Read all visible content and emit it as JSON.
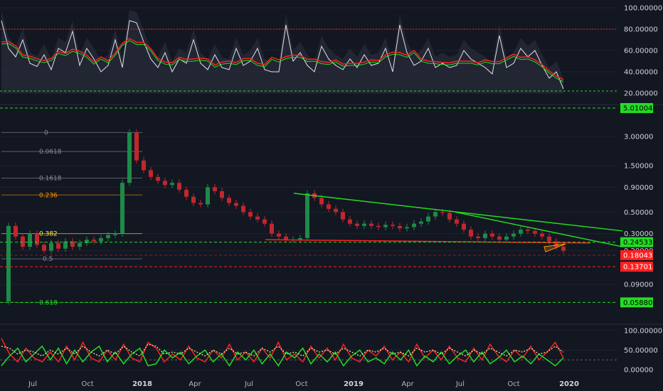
{
  "colors": {
    "background": "#131722",
    "grid": "#1e222d",
    "axis_text": "#d1d4dc",
    "pane_border": "#2a2e39",
    "green": "#22dd22",
    "red": "#ff2020",
    "price_candle_red": "#c1272d",
    "price_candle_green": "#1e8a48",
    "orange": "#ff9800",
    "yellow": "#ffeb3b",
    "fib_grey": "#8a8e99"
  },
  "chart_data": [
    {
      "type": "line",
      "pane": "top-indicator",
      "y_axis_ticks": [
        "100.00000",
        "80.00000",
        "60.00000",
        "40.00000",
        "20.00000"
      ],
      "ylim": [
        20,
        100
      ],
      "hlines": [
        80,
        22
      ],
      "series": [
        {
          "values": [
            88,
            62,
            54,
            70,
            48,
            45,
            56,
            42,
            62,
            58,
            78,
            46,
            62,
            52,
            40,
            46,
            70,
            44,
            88,
            86,
            68,
            52,
            44,
            58,
            40,
            52,
            48,
            70,
            48,
            42,
            56,
            44,
            42,
            62,
            46,
            50,
            62,
            42,
            40,
            40,
            84,
            50,
            58,
            46,
            40,
            64,
            52,
            46,
            42,
            52,
            44,
            56,
            46,
            48,
            62,
            40,
            84,
            58,
            46,
            50,
            62,
            44,
            48,
            44,
            46,
            60,
            52,
            48,
            44,
            38,
            74,
            44,
            48,
            62,
            54,
            60,
            46,
            34,
            40,
            24
          ]
        }
      ],
      "x_range": [
        "2017-05",
        "2019-12"
      ]
    },
    {
      "type": "line",
      "pane": "price",
      "scale": "log",
      "y_axis_ticks": [
        "3.00000",
        "1.50000",
        "0.90000",
        "0.50000",
        "0.30000",
        "0.20000",
        "0.09000"
      ],
      "ylim": [
        0.05,
        4.2
      ],
      "series": [
        {
          "values": [
            0.06,
            0.36,
            0.28,
            0.22,
            0.3,
            0.23,
            0.2,
            0.24,
            0.21,
            0.25,
            0.22,
            0.24,
            0.26,
            0.25,
            0.27,
            0.29,
            0.3,
            1.0,
            3.3,
            1.7,
            1.35,
            1.15,
            1.05,
            0.95,
            1.0,
            0.85,
            0.72,
            0.62,
            0.6,
            0.9,
            0.82,
            0.7,
            0.62,
            0.58,
            0.5,
            0.45,
            0.42,
            0.38,
            0.3,
            0.28,
            0.26,
            0.26,
            0.27,
            0.78,
            0.7,
            0.6,
            0.54,
            0.5,
            0.42,
            0.38,
            0.36,
            0.38,
            0.36,
            0.35,
            0.37,
            0.36,
            0.34,
            0.35,
            0.38,
            0.4,
            0.45,
            0.5,
            0.49,
            0.42,
            0.38,
            0.33,
            0.28,
            0.27,
            0.3,
            0.28,
            0.26,
            0.28,
            0.3,
            0.33,
            0.32,
            0.3,
            0.28,
            0.25,
            0.22,
            0.2
          ]
        }
      ],
      "x_range": [
        "2017-05",
        "2019-12"
      ],
      "fibonacci_levels": [
        {
          "label": "0",
          "value": 3.3
        },
        {
          "label": "0.0618",
          "value": 2.1
        },
        {
          "label": "0.1618",
          "value": 1.12
        },
        {
          "label": "0.236",
          "value": 0.75
        },
        {
          "label": "0.382",
          "value": 0.3
        },
        {
          "label": "0.5",
          "value": 0.165
        },
        {
          "label": "0.618",
          "value": 0.0588
        }
      ],
      "price_tags": [
        {
          "label": "5.01004",
          "color": "#22dd22"
        },
        {
          "label": "0.24533",
          "color": "#22dd22"
        },
        {
          "label": "0.18043",
          "color": "#ff2020"
        },
        {
          "label": "0.13701",
          "color": "#ff2020"
        },
        {
          "label": "0.05880",
          "color": "#22dd22"
        }
      ]
    },
    {
      "type": "line",
      "pane": "bottom-oscillator",
      "y_axis_ticks": [
        "100.00000",
        "50.00000",
        "0.00000"
      ],
      "ylim": [
        0,
        100
      ],
      "hlines": [
        25,
        80
      ],
      "series": [
        {
          "values": [
            80,
            40,
            20,
            55,
            30,
            20,
            45,
            20,
            60,
            25,
            70,
            30,
            20,
            50,
            25,
            65,
            30,
            20,
            70,
            55,
            20,
            40,
            25,
            60,
            30,
            20,
            50,
            30,
            65,
            25,
            45,
            20,
            55,
            30,
            70,
            25,
            40,
            20,
            60,
            30,
            55,
            25,
            65,
            30,
            20,
            50,
            35,
            60,
            25,
            45,
            20,
            65,
            30,
            50,
            25,
            60,
            30,
            20,
            55,
            25,
            65,
            35,
            20,
            50,
            30,
            60,
            25,
            45,
            70,
            30
          ]
        },
        {
          "values": [
            10,
            35,
            55,
            20,
            40,
            60,
            25,
            55,
            15,
            50,
            20,
            45,
            60,
            20,
            45,
            15,
            40,
            55,
            10,
            15,
            50,
            30,
            45,
            15,
            35,
            50,
            20,
            40,
            10,
            45,
            25,
            50,
            15,
            40,
            10,
            45,
            30,
            55,
            15,
            40,
            20,
            45,
            10,
            35,
            50,
            20,
            30,
            15,
            45,
            25,
            50,
            10,
            35,
            20,
            45,
            15,
            35,
            50,
            20,
            45,
            15,
            30,
            50,
            20,
            35,
            15,
            40,
            25,
            10,
            30
          ]
        },
        {
          "values": [
            60,
            55,
            40,
            50,
            45,
            35,
            50,
            40,
            55,
            40,
            60,
            45,
            35,
            50,
            40,
            60,
            45,
            35,
            65,
            60,
            40,
            45,
            40,
            55,
            45,
            35,
            50,
            40,
            55,
            40,
            45,
            35,
            55,
            45,
            60,
            40,
            45,
            35,
            55,
            45,
            50,
            40,
            55,
            45,
            35,
            50,
            45,
            55,
            40,
            45,
            35,
            55,
            45,
            50,
            40,
            55,
            45,
            35,
            50,
            40,
            55,
            45,
            35,
            50,
            45,
            55,
            40,
            45,
            60,
            45
          ]
        }
      ],
      "x_range": [
        "2017-05",
        "2019-12"
      ]
    }
  ],
  "x_axis": {
    "labels": [
      "Jul",
      "Oct",
      "2018",
      "Apr",
      "Jul",
      "Oct",
      "2019",
      "Apr",
      "Jul",
      "Oct",
      "2020"
    ]
  }
}
